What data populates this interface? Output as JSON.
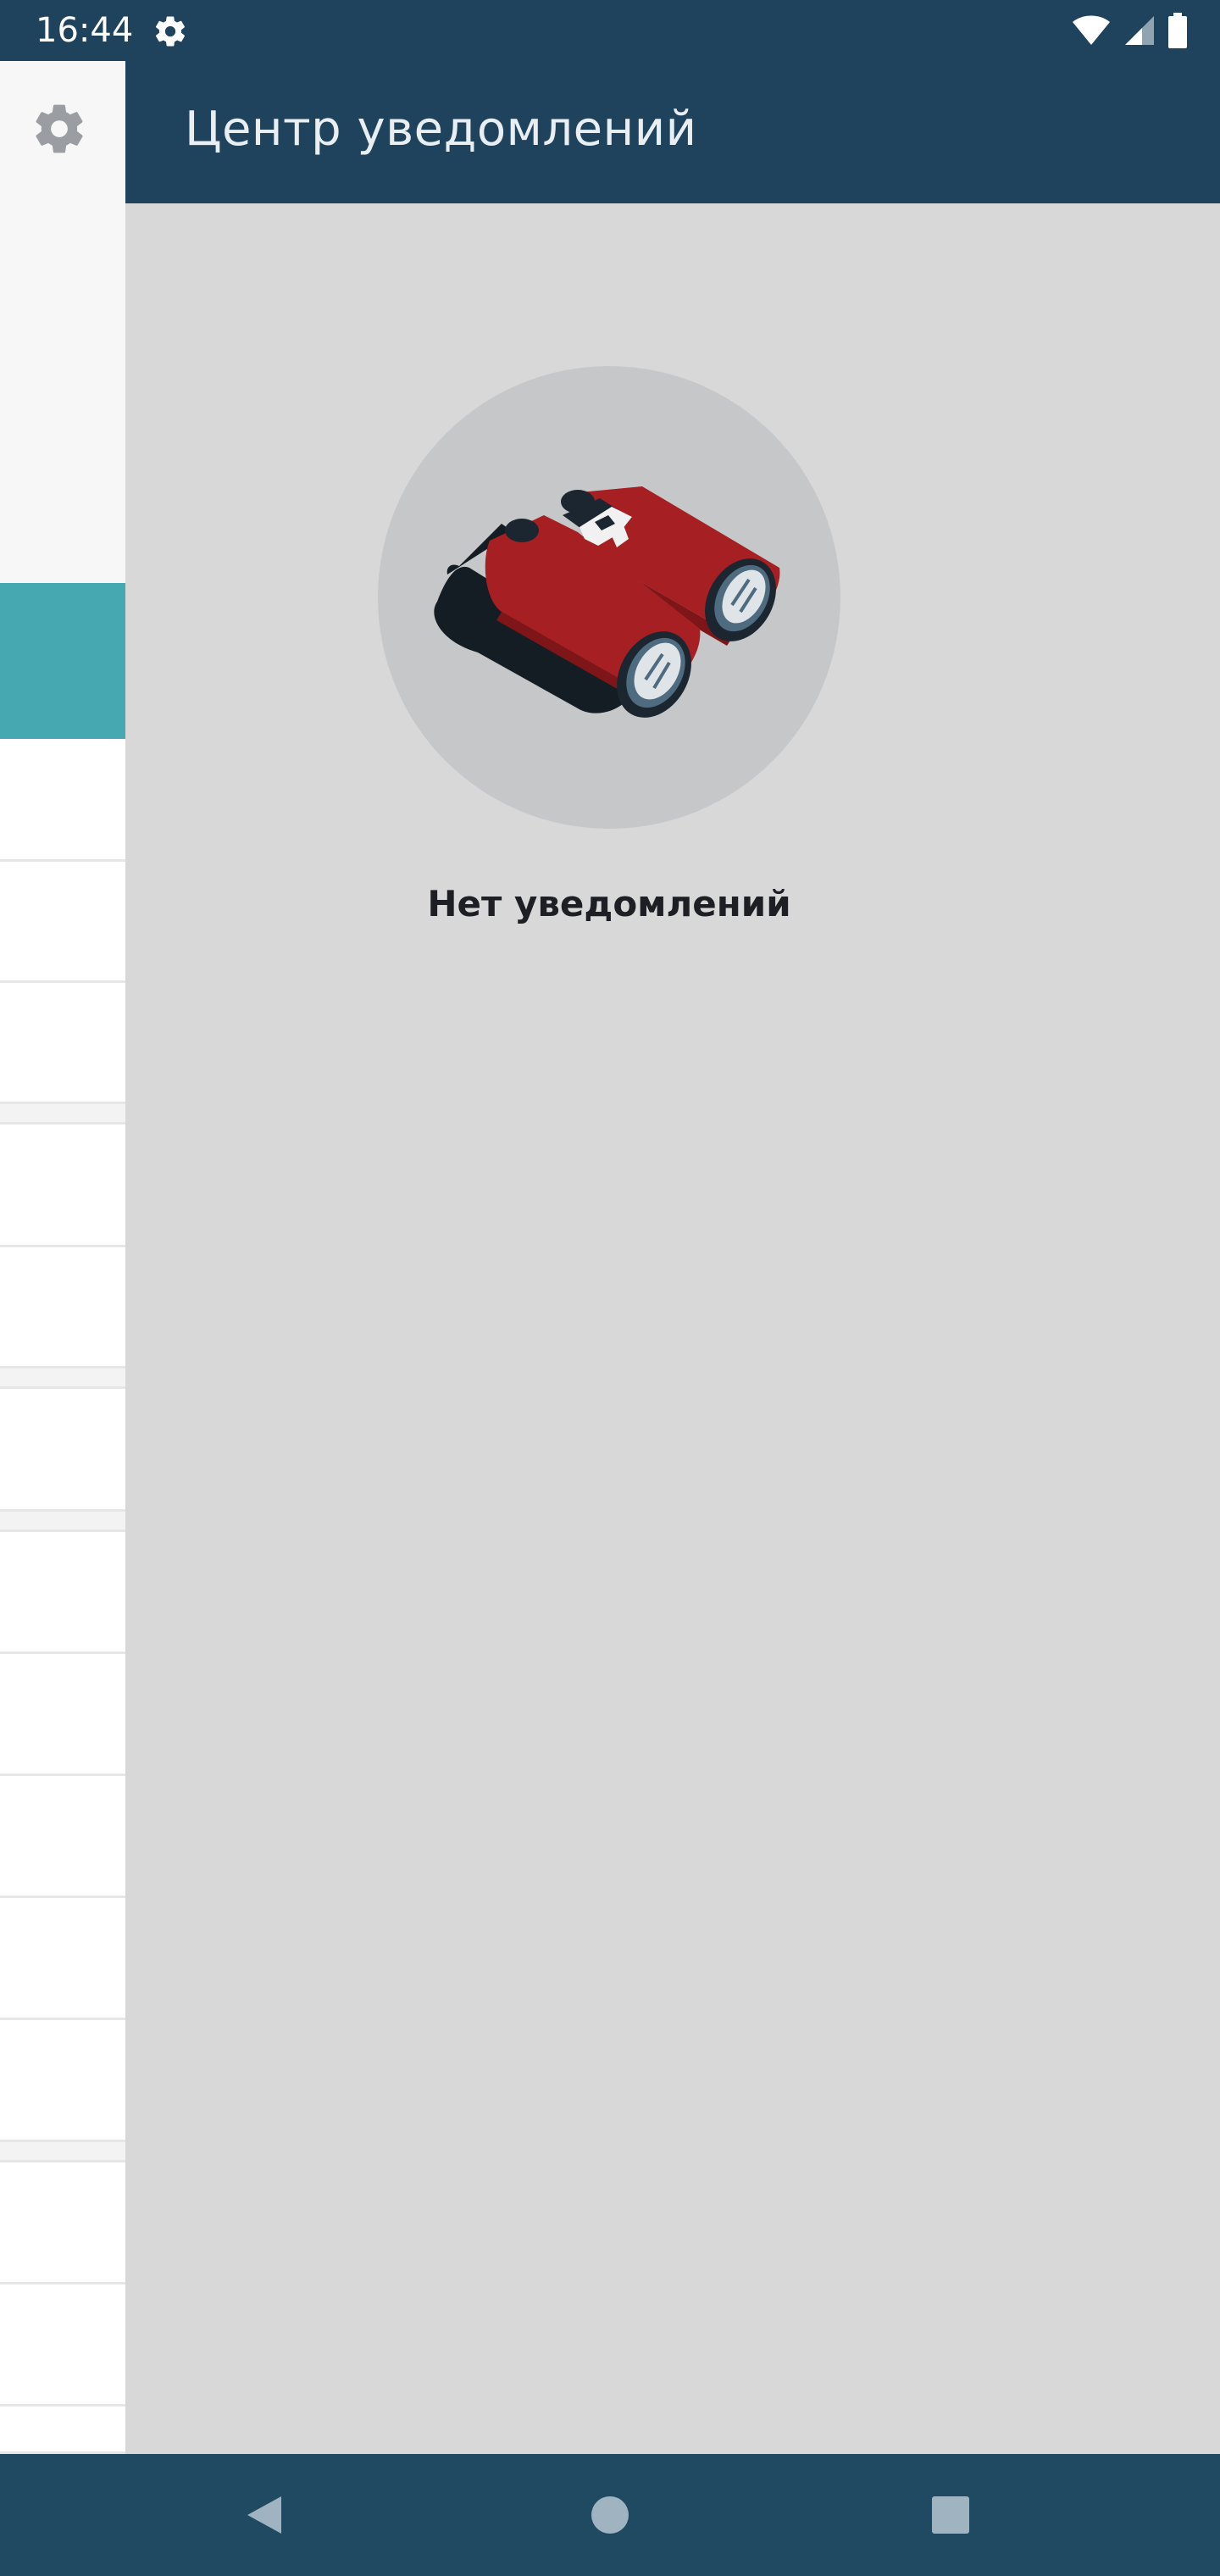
{
  "status_bar": {
    "time": "16:44",
    "icons": [
      "settings-icon",
      "wifi-icon",
      "signal-icon",
      "battery-icon"
    ]
  },
  "background_panel": {
    "icon": "gear-icon",
    "accent_color": "#46a9b1"
  },
  "drawer": {
    "title": "Центр уведомлений",
    "empty_state": {
      "illustration": "binoculars-icon",
      "message": "Нет уведомлений"
    }
  },
  "nav_bar": {
    "buttons": [
      "back-icon",
      "home-icon",
      "recent-apps-icon"
    ]
  },
  "colors": {
    "primary": "#1f435c",
    "drawer_background": "#d8d8d9",
    "illustration_red": "#a61f23"
  }
}
